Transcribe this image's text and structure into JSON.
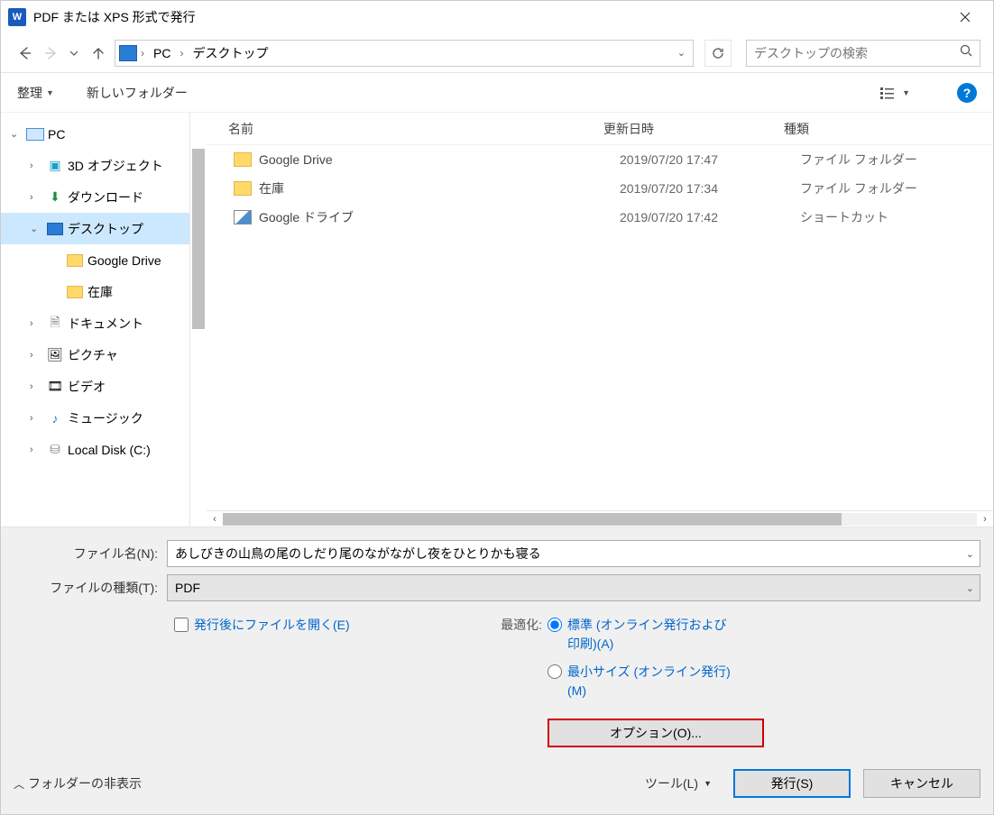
{
  "titlebar": {
    "title": "PDF または XPS 形式で発行"
  },
  "nav": {
    "crumbs": [
      "PC",
      "デスクトップ"
    ],
    "search_placeholder": "デスクトップの検索"
  },
  "toolbar": {
    "organize": "整理",
    "new_folder": "新しいフォルダー"
  },
  "sidebar": {
    "items": [
      {
        "label": "PC",
        "icon": "pc",
        "indent": 0,
        "chev": "down",
        "selected": false
      },
      {
        "label": "3D オブジェクト",
        "icon": "3d",
        "indent": 1,
        "chev": "right",
        "selected": false
      },
      {
        "label": "ダウンロード",
        "icon": "down",
        "indent": 1,
        "chev": "right",
        "selected": false
      },
      {
        "label": "デスクトップ",
        "icon": "desktop",
        "indent": 1,
        "chev": "down",
        "selected": true
      },
      {
        "label": "Google Drive",
        "icon": "folder",
        "indent": 2,
        "chev": "",
        "selected": false
      },
      {
        "label": "在庫",
        "icon": "folder",
        "indent": 2,
        "chev": "",
        "selected": false
      },
      {
        "label": "ドキュメント",
        "icon": "doc",
        "indent": 1,
        "chev": "right",
        "selected": false
      },
      {
        "label": "ピクチャ",
        "icon": "pic",
        "indent": 1,
        "chev": "right",
        "selected": false
      },
      {
        "label": "ビデオ",
        "icon": "vid",
        "indent": 1,
        "chev": "right",
        "selected": false
      },
      {
        "label": "ミュージック",
        "icon": "mus",
        "indent": 1,
        "chev": "right",
        "selected": false
      },
      {
        "label": "Local Disk (C:)",
        "icon": "disk",
        "indent": 1,
        "chev": "right",
        "selected": false
      }
    ]
  },
  "list": {
    "headers": {
      "name": "名前",
      "date": "更新日時",
      "type": "種類"
    },
    "rows": [
      {
        "name": "Google Drive",
        "date": "2019/07/20 17:47",
        "type": "ファイル フォルダー",
        "icon": "folder"
      },
      {
        "name": "在庫",
        "date": "2019/07/20 17:34",
        "type": "ファイル フォルダー",
        "icon": "folder"
      },
      {
        "name": "Google ドライブ",
        "date": "2019/07/20 17:42",
        "type": "ショートカット",
        "icon": "shortcut"
      }
    ]
  },
  "fields": {
    "filename_label": "ファイル名(N):",
    "filename_value": "あしびきの山鳥の尾のしだり尾のながながし夜をひとりかも寝る",
    "filetype_label": "ファイルの種類(T):",
    "filetype_value": "PDF"
  },
  "options": {
    "open_after": "発行後にファイルを開く(E)",
    "optimize_label": "最適化:",
    "radio_standard": "標準 (オンライン発行および印刷)(A)",
    "radio_min": "最小サイズ (オンライン発行)(M)",
    "options_button": "オプション(O)..."
  },
  "footer": {
    "hide_folders": "フォルダーの非表示",
    "tools": "ツール(L)",
    "publish": "発行(S)",
    "cancel": "キャンセル"
  }
}
